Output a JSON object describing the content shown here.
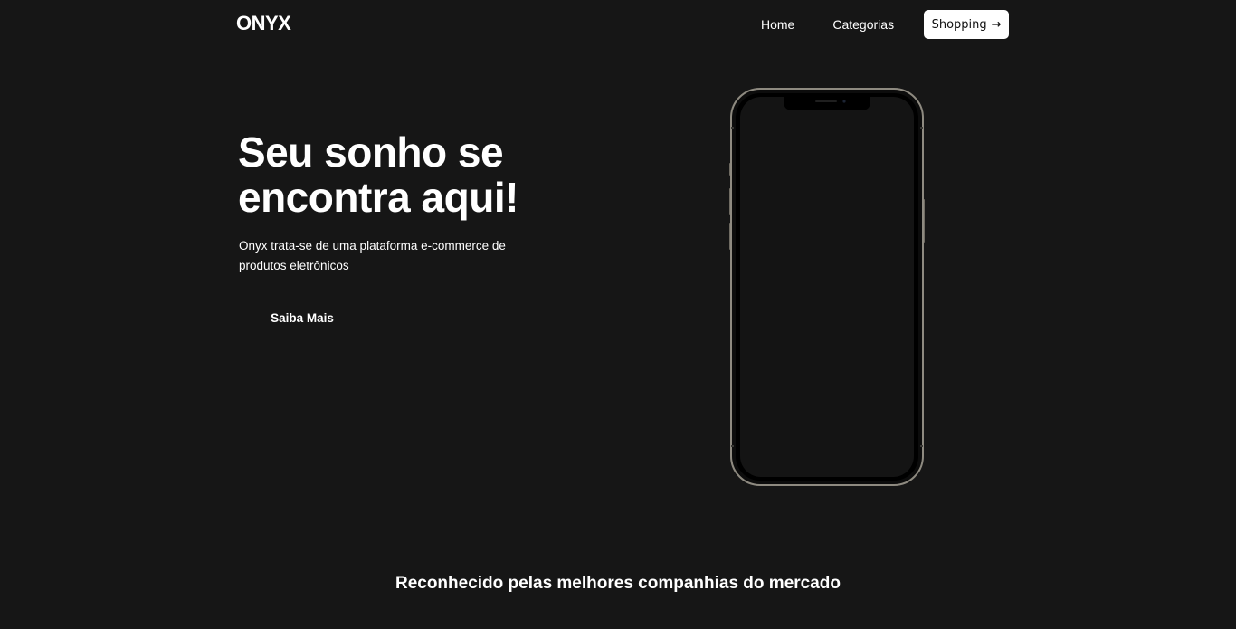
{
  "header": {
    "logo": "ONYX",
    "nav": {
      "home_label": "Home",
      "categories_label": "Categorias",
      "shopping_label": "Shopping",
      "shopping_icon": "arrow-right-icon"
    }
  },
  "hero": {
    "title": "Seu sonho se encontra aqui!",
    "description": "Onyx trata-se de uma plataforma e-commerce de produtos eletrônicos",
    "cta_label": "Saiba Mais",
    "image": "smartphone-image"
  },
  "partners": {
    "title": "Reconhecido pelas melhores companhias do mercado"
  },
  "colors": {
    "background": "#161616",
    "text": "#ffffff",
    "button_bg": "#ffffff",
    "button_text": "#111111"
  }
}
